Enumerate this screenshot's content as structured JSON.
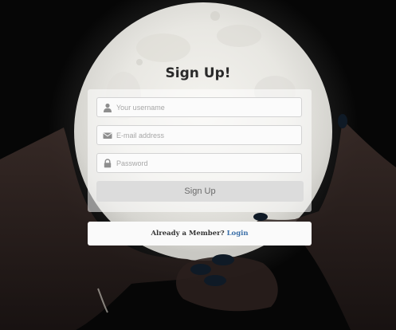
{
  "form": {
    "title": "Sign Up!",
    "username": {
      "placeholder": "Your username",
      "icon": "user-icon"
    },
    "email": {
      "placeholder": "E-mail address",
      "icon": "envelope-icon"
    },
    "password": {
      "placeholder": "Password",
      "icon": "lock-icon"
    },
    "submit_label": "Sign Up"
  },
  "footer": {
    "prompt": "Already a Member?",
    "login_label": "Login"
  },
  "colors": {
    "background": "#050505",
    "panel": "#ffffff",
    "link": "#3b6fa8",
    "button": "#dcdcdc"
  }
}
